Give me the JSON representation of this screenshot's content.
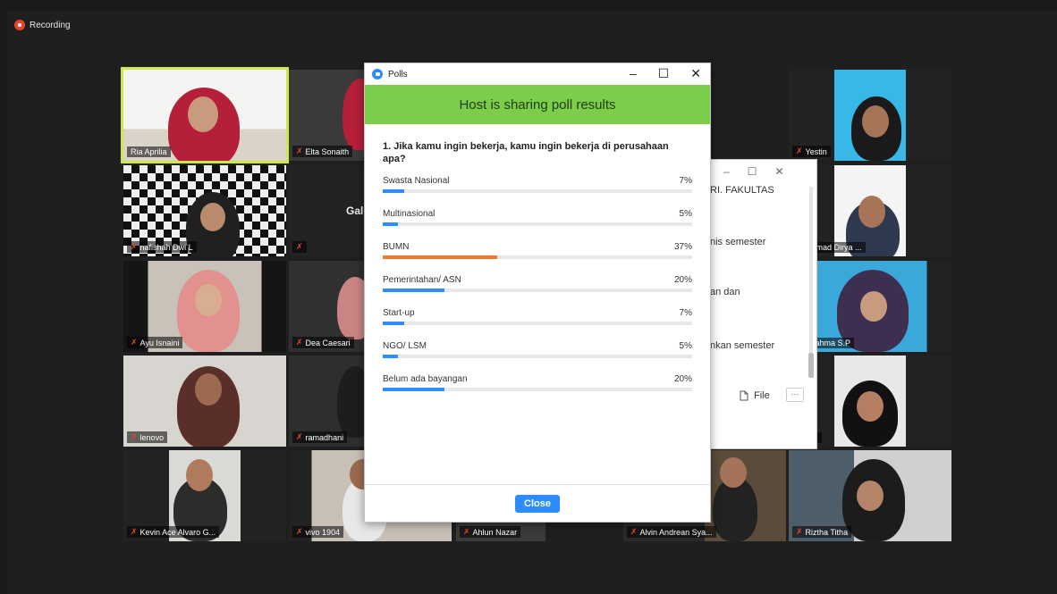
{
  "recording": {
    "label": "Recording"
  },
  "participants": [
    {
      "name": "Ria Aprilia",
      "muted": false,
      "active": true
    },
    {
      "name": "Elta Sonaith",
      "muted": true
    },
    {
      "name": "Yestin",
      "muted": true
    },
    {
      "name": "nafishah Dwi L",
      "muted": true
    },
    {
      "name": "Gal",
      "muted": true
    },
    {
      "name": "uhammad Dirya ...",
      "muted": false
    },
    {
      "name": "Ayu Isnaini",
      "muted": true
    },
    {
      "name": "Dea Caesari",
      "muted": true
    },
    {
      "name": "nta Rahma S.P",
      "muted": false
    },
    {
      "name": "lenovo",
      "muted": true
    },
    {
      "name": "ramadhani",
      "muted": true
    },
    {
      "name": "midah",
      "muted": false
    },
    {
      "name": "Kevin Ace Alvaro G...",
      "muted": true
    },
    {
      "name": "vivo 1904",
      "muted": true
    },
    {
      "name": "Ahlun Nazar",
      "muted": true
    },
    {
      "name": "Alvin Andrean Sya...",
      "muted": true
    },
    {
      "name": "Riztha Titha",
      "muted": true
    }
  ],
  "chat_window": {
    "lines": [
      "RI. FAKULTAS",
      "nis semester",
      "an dan",
      "nkan semester"
    ],
    "file_label": "File",
    "more_label": "···"
  },
  "polls": {
    "window_title": "Polls",
    "header": "Host is sharing poll results",
    "question": "1. Jika kamu ingin bekerja, kamu ingin bekerja di perusahaan apa?",
    "options": [
      {
        "label": "Swasta Nasional",
        "pct": "7%",
        "value": 0.07
      },
      {
        "label": "Multinasional",
        "pct": "5%",
        "value": 0.05
      },
      {
        "label": "BUMN",
        "pct": "37%",
        "value": 0.37,
        "highlight": true
      },
      {
        "label": "Pemerintahan/ ASN",
        "pct": "20%",
        "value": 0.2
      },
      {
        "label": "Start-up",
        "pct": "7%",
        "value": 0.07
      },
      {
        "label": "NGO/ LSM",
        "pct": "5%",
        "value": 0.05
      },
      {
        "label": "Belum ada bayangan",
        "pct": "20%",
        "value": 0.2
      }
    ],
    "close_label": "Close",
    "colors": {
      "accent": "#2d8cff",
      "highlight": "#ef7a2c",
      "header": "#7ccd49"
    }
  }
}
